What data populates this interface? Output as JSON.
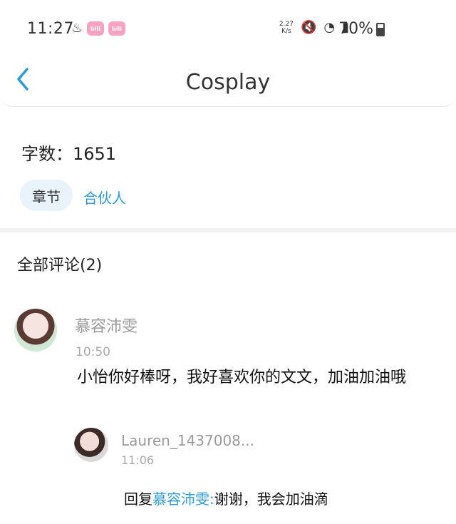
{
  "status_bar": {
    "time": "11:27",
    "left_icons": [
      "drop-icon",
      "bilibili-icon",
      "bilibili-icon"
    ],
    "net_speed_value": "2.27",
    "net_speed_unit": "K/s",
    "battery": "70%",
    "battery_level": 0.7
  },
  "header": {
    "title": "Cosplay",
    "back_icon": "chevron-left-icon"
  },
  "info": {
    "word_count": "字数：1651",
    "chip_label": "章节",
    "tag_label": "合伙人"
  },
  "comments": {
    "title": "全部评论(2)",
    "items": [
      {
        "username": "慕容沛雯",
        "time": "10:50",
        "content": "小怡你好棒呀，我好喜欢你的文文，加油加油哦",
        "reply": {
          "username": "Lauren_1437008...",
          "time": "11:06",
          "prefix": "回复",
          "target": "慕容沛雯:",
          "text": "谢谢，我会加油滴"
        }
      }
    ]
  },
  "colors": {
    "accent": "#2a9bd8",
    "chip_bg": "#e8f3fb",
    "muted": "#9a9a9a"
  }
}
